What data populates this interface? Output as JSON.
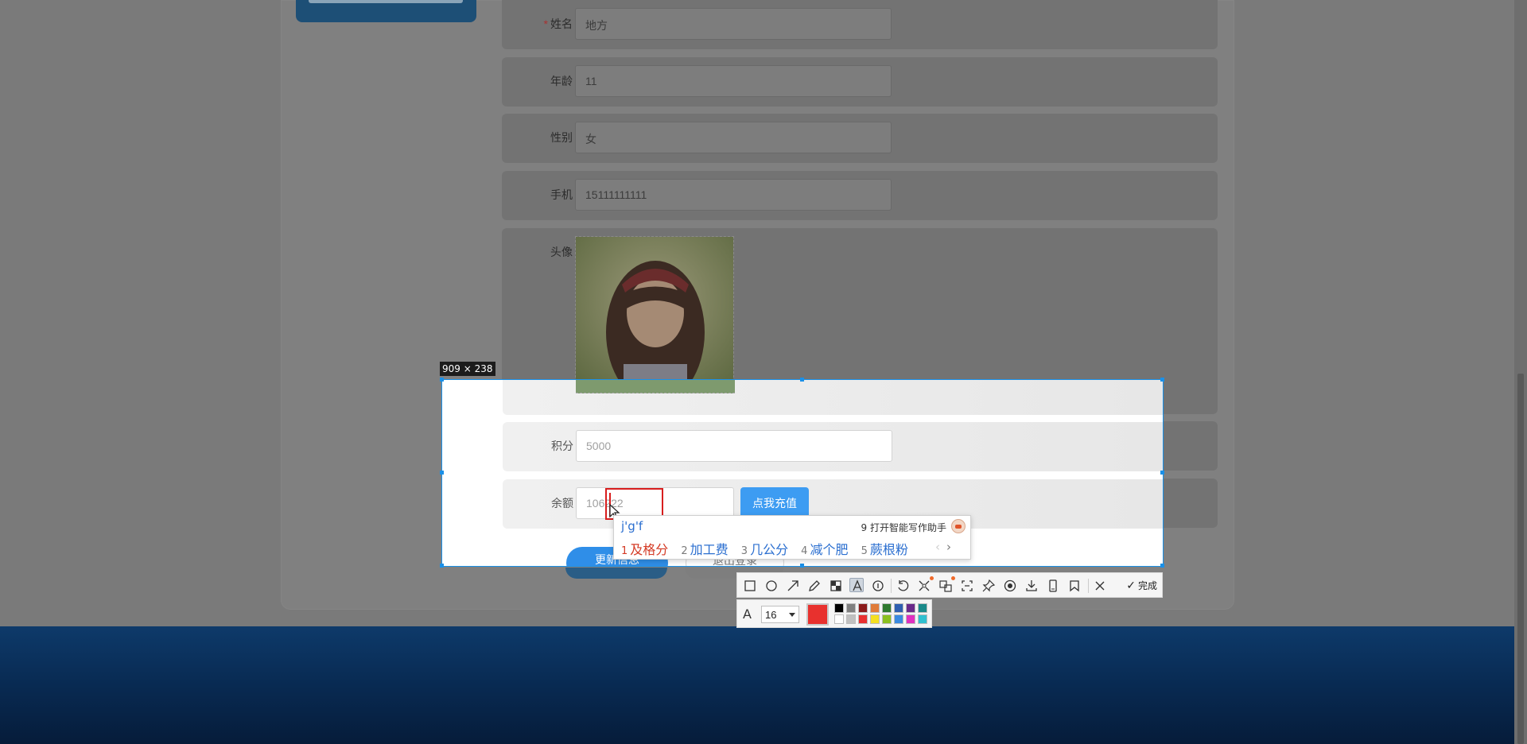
{
  "form": {
    "name_label": "姓名",
    "name_required_mark": "*",
    "name_value": "地方",
    "age_label": "年龄",
    "age_value": "11",
    "gender_label": "性别",
    "gender_value": "女",
    "phone_label": "手机",
    "phone_value": "15111111111",
    "avatar_label": "头像",
    "points_label": "积分",
    "points_value": "5000",
    "balance_label": "余额",
    "balance_value": "106222",
    "recharge_button": "点我充值",
    "update_button": "更新信息",
    "logout_button": "退出登录"
  },
  "screenshot_tool": {
    "selection_size_label": "909 × 238",
    "done_label": "完成",
    "font_size_value": "16",
    "current_color": "#e8312e",
    "tools": [
      "rectangle-icon",
      "ellipse-icon",
      "arrow-icon",
      "pen-icon",
      "mosaic-icon",
      "text-icon",
      "serial-number-icon",
      "undo-icon",
      "ocr-icon",
      "translate-icon",
      "long-screenshot-icon",
      "pin-icon",
      "record-icon",
      "download-icon",
      "save-icon",
      "bookmark-icon",
      "close-icon",
      "confirm-icon"
    ],
    "palette": [
      "#000000",
      "#808080",
      "#8b1a1a",
      "#e07b39",
      "#2f7a2f",
      "#2f5fb0",
      "#6a2a8a",
      "#1a8a8a",
      "#ffffff",
      "#c0c0c0",
      "#e83030",
      "#f5e020",
      "#8ac020",
      "#3a8ae0",
      "#e030c0",
      "#30c0d0"
    ]
  },
  "ime": {
    "composition": "j'g'f",
    "helper_number": "9",
    "helper_label": "打开智能写作助手",
    "candidates": [
      {
        "num": "1",
        "text": "及格分"
      },
      {
        "num": "2",
        "text": "加工费"
      },
      {
        "num": "3",
        "text": "几公分"
      },
      {
        "num": "4",
        "text": "减个肥"
      },
      {
        "num": "5",
        "text": "蕨根粉"
      }
    ],
    "prev_page": "‹",
    "next_page": "›"
  }
}
